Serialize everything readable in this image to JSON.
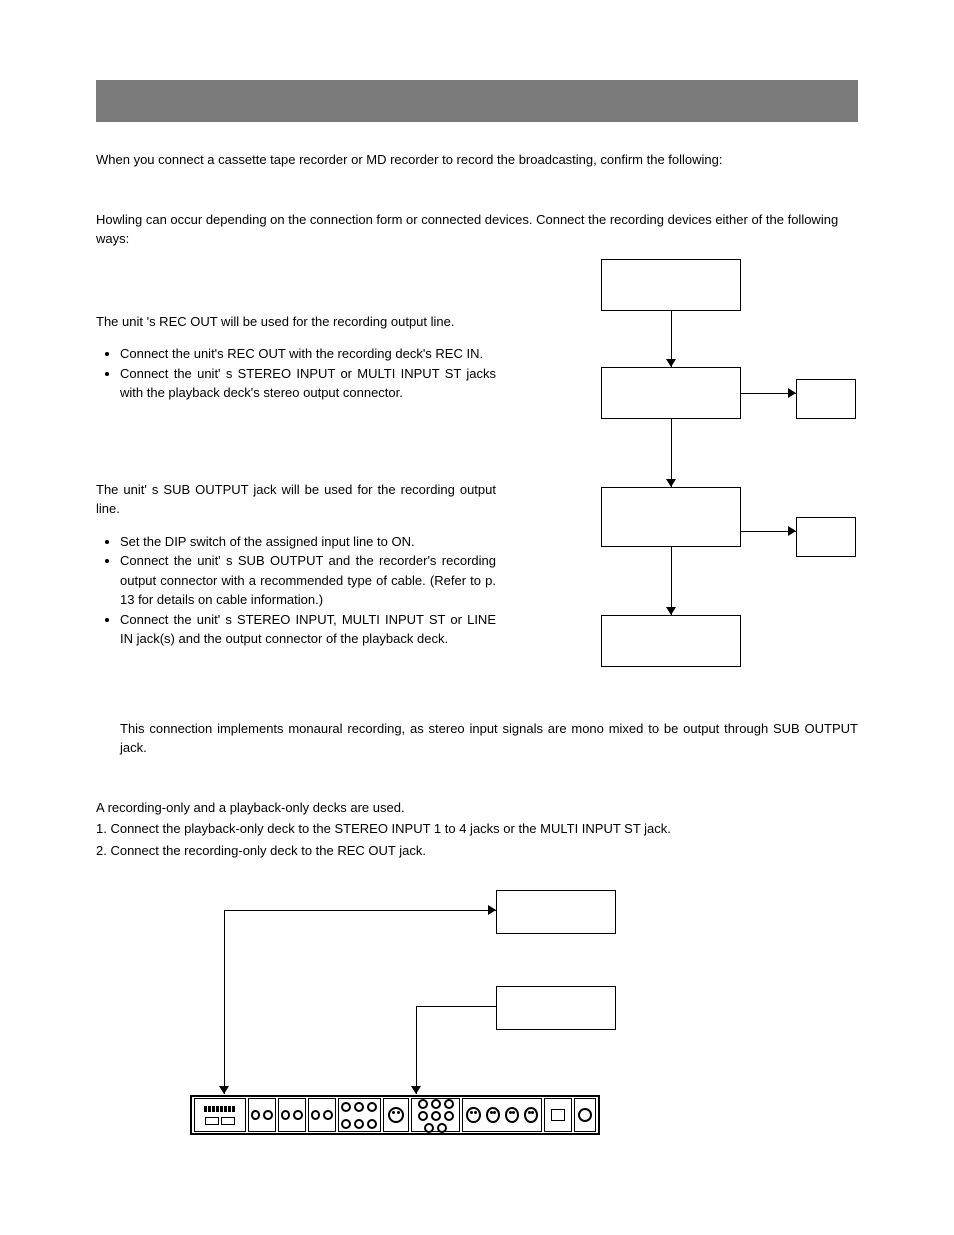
{
  "intro": "When you connect a cassette tape recorder or MD recorder to record the broadcasting, confirm the following:",
  "howling": "Howling can occur depending on the connection form or connected devices. Connect the recording devices either of the following ways:",
  "method1": {
    "lead": "The unit 's REC OUT will be used for the recording output line.",
    "bullets": [
      "Connect the unit's REC OUT with the recording deck's REC IN.",
      "Connect the unit' s STEREO INPUT or MULTI INPUT ST jacks with the playback deck's stereo output connector."
    ]
  },
  "method2": {
    "lead": "The unit' s SUB OUTPUT jack will be used for the recording output line.",
    "bullets": [
      "Set the DIP switch of the assigned input line to ON.",
      "Connect the unit' s SUB OUTPUT and the recorder's recording output connector with a recommended type of cable. (Refer to p. 13 for details on cable information.)",
      "Connect the unit' s STEREO INPUT, MULTI INPUT ST or LINE IN jack(s) and the output connector of the playback deck."
    ],
    "note": "This connection implements monaural recording, as stereo input signals are mono mixed to be output through SUB OUTPUT jack."
  },
  "deck_section": {
    "lead": "A recording-only and a playback-only decks are used.",
    "step1": "1. Connect the playback-only deck to the STEREO INPUT 1 to 4 jacks or the MULTI INPUT ST jack.",
    "step2": "2. Connect the recording-only deck to the REC OUT jack."
  }
}
